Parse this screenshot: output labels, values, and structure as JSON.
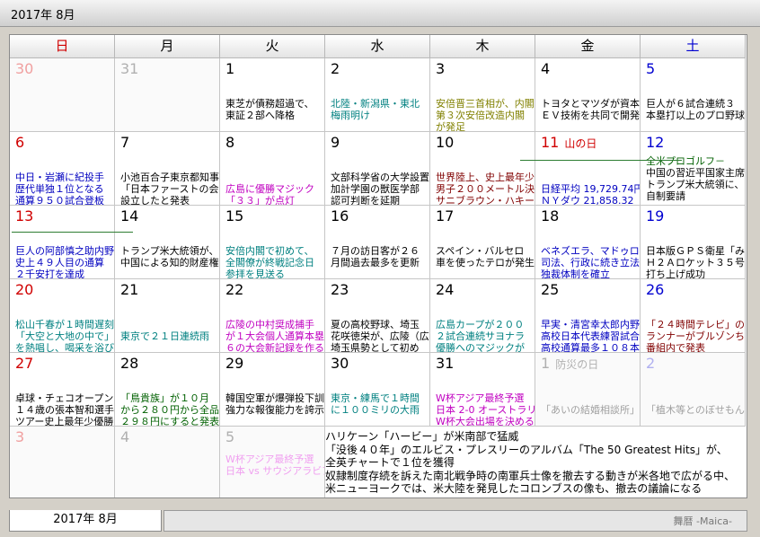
{
  "title": "2017年 8月",
  "tab_label": "2017年 8月",
  "brand": "舞暦 -Maica-",
  "weekdays": [
    {
      "label": "日",
      "color": "#d00000"
    },
    {
      "label": "月",
      "color": "#000000"
    },
    {
      "label": "火",
      "color": "#000000"
    },
    {
      "label": "水",
      "color": "#000000"
    },
    {
      "label": "木",
      "color": "#000000"
    },
    {
      "label": "金",
      "color": "#000000"
    },
    {
      "label": "土",
      "color": "#0000d0"
    }
  ],
  "weeks": [
    [
      {
        "day": "30",
        "color": "#f0a0a0",
        "dim": true,
        "events": []
      },
      {
        "day": "31",
        "color": "#b0b0b0",
        "dim": true,
        "events": []
      },
      {
        "day": "1",
        "color": "#000000",
        "events": [
          {
            "text": "東芝が債務超過で、",
            "color": "#000000"
          },
          {
            "text": "東証２部へ降格",
            "color": "#000000"
          }
        ]
      },
      {
        "day": "2",
        "color": "#000000",
        "events": [
          {
            "text": "北陸・新潟県・東北",
            "color": "#008080"
          },
          {
            "text": "梅雨明け",
            "color": "#008080"
          }
        ]
      },
      {
        "day": "3",
        "color": "#000000",
        "events": [
          {
            "text": "安倍晋三首相が、内閣",
            "color": "#808000"
          },
          {
            "text": "第３次安倍改造内閣",
            "color": "#808000"
          },
          {
            "text": "が発足",
            "color": "#808000"
          }
        ]
      },
      {
        "day": "4",
        "color": "#000000",
        "events": [
          {
            "text": "トヨタとマツダが資本",
            "color": "#000000"
          },
          {
            "text": "ＥＶ技術を共同で開発",
            "color": "#000000"
          }
        ]
      },
      {
        "day": "5",
        "color": "#0000d0",
        "events": [
          {
            "text": "巨人が６試合連続３",
            "color": "#000000"
          },
          {
            "text": "本塁打以上のプロ野球",
            "color": "#000000"
          }
        ]
      }
    ],
    [
      {
        "day": "6",
        "color": "#d00000",
        "events": [
          {
            "text": "中日・岩瀬に紀投手",
            "color": "#0000c0"
          },
          {
            "text": "歴代単独１位となる",
            "color": "#0000c0"
          },
          {
            "text": "通算９５０試合登板",
            "color": "#0000c0"
          }
        ]
      },
      {
        "day": "7",
        "color": "#000000",
        "events": [
          {
            "text": "小池百合子東京都知事",
            "color": "#000000"
          },
          {
            "text": "「日本ファーストの会",
            "color": "#000000"
          },
          {
            "text": "設立したと発表",
            "color": "#000000"
          }
        ]
      },
      {
        "day": "8",
        "color": "#000000",
        "events": [
          {
            "text": "",
            "color": "#000000"
          },
          {
            "text": "広島に優勝マジック",
            "color": "#c000c0"
          },
          {
            "text": "「３３」が点灯",
            "color": "#c000c0"
          }
        ]
      },
      {
        "day": "9",
        "color": "#000000",
        "events": [
          {
            "text": "文部科学省の大学設置",
            "color": "#000000"
          },
          {
            "text": "加計学園の獣医学部",
            "color": "#000000"
          },
          {
            "text": "認可判断を延期",
            "color": "#000000"
          }
        ]
      },
      {
        "day": "10",
        "color": "#000000",
        "events": [
          {
            "text": "世界陸上、史上最年少",
            "color": "#800000"
          },
          {
            "text": "男子２００メートル決",
            "color": "#800000"
          },
          {
            "text": "サニブラウン・ハキーム",
            "color": "#800000"
          }
        ]
      },
      {
        "day": "11",
        "color": "#d00000",
        "holiday": "山の日",
        "events": [
          {
            "text": "",
            "color": "#000000"
          },
          {
            "text": "日経平均 19,729.74円",
            "color": "#0000c0"
          },
          {
            "text": "ＮＹダウ 21,858.32",
            "color": "#0000c0"
          }
        ]
      },
      {
        "day": "12",
        "color": "#0000d0",
        "events": [
          {
            "text": "全米プロゴルフ－",
            "color": "#006000"
          },
          {
            "text": "中国の習近平国家主席",
            "color": "#000000"
          },
          {
            "text": "トランプ米大統領に、",
            "color": "#000000"
          },
          {
            "text": "自制要請",
            "color": "#000000"
          }
        ]
      }
    ],
    [
      {
        "day": "13",
        "color": "#d00000",
        "events": [
          {
            "text": "巨人の阿部慎之助内野",
            "color": "#0000c0"
          },
          {
            "text": "史上４９人目の通算",
            "color": "#0000c0"
          },
          {
            "text": "２千安打を達成",
            "color": "#0000c0"
          }
        ]
      },
      {
        "day": "14",
        "color": "#000000",
        "events": [
          {
            "text": "トランプ米大統領が、",
            "color": "#000000"
          },
          {
            "text": "中国による知的財産権",
            "color": "#000000"
          }
        ]
      },
      {
        "day": "15",
        "color": "#000000",
        "events": [
          {
            "text": "安倍内閣で初めて、",
            "color": "#008080"
          },
          {
            "text": "全閣僚が終戦記念日",
            "color": "#008080"
          },
          {
            "text": "参拝を見送る",
            "color": "#008080"
          }
        ]
      },
      {
        "day": "16",
        "color": "#000000",
        "events": [
          {
            "text": "７月の訪日客が２６",
            "color": "#000000"
          },
          {
            "text": "月間過去最多を更新",
            "color": "#000000"
          }
        ]
      },
      {
        "day": "17",
        "color": "#000000",
        "events": [
          {
            "text": "スペイン・バルセロ",
            "color": "#000000"
          },
          {
            "text": "車を使ったテロが発生",
            "color": "#000000"
          }
        ]
      },
      {
        "day": "18",
        "color": "#000000",
        "events": [
          {
            "text": "ベネズエラ、マドゥロ",
            "color": "#0000c0"
          },
          {
            "text": "司法、行政に続き立法",
            "color": "#0000c0"
          },
          {
            "text": "独裁体制を確立",
            "color": "#0000c0"
          }
        ]
      },
      {
        "day": "19",
        "color": "#0000d0",
        "events": [
          {
            "text": "日本版ＧＰＳ衛星「み",
            "color": "#000000"
          },
          {
            "text": "Ｈ２Ａロケット３５号",
            "color": "#000000"
          },
          {
            "text": "打ち上げ成功",
            "color": "#000000"
          }
        ]
      }
    ],
    [
      {
        "day": "20",
        "color": "#d00000",
        "events": [
          {
            "text": "松山千春が１時間遅刻",
            "color": "#008080"
          },
          {
            "text": "「大空と大地の中で」",
            "color": "#008080"
          },
          {
            "text": "を熱唱し、喝采を浴び",
            "color": "#008080"
          }
        ]
      },
      {
        "day": "21",
        "color": "#000000",
        "events": [
          {
            "text": "",
            "color": "#000000"
          },
          {
            "text": "東京で２１日連続雨",
            "color": "#008080"
          }
        ]
      },
      {
        "day": "22",
        "color": "#000000",
        "events": [
          {
            "text": "広陵の中村奨成捕手",
            "color": "#c000c0"
          },
          {
            "text": "が１大会個人通算本塁",
            "color": "#c000c0"
          },
          {
            "text": "６の大会新記録を作る",
            "color": "#c000c0"
          }
        ]
      },
      {
        "day": "23",
        "color": "#000000",
        "events": [
          {
            "text": "夏の高校野球、埼玉",
            "color": "#000000"
          },
          {
            "text": "花咲徳栄が、広陵（広",
            "color": "#000000"
          },
          {
            "text": "埼玉県勢として初め",
            "color": "#000000"
          }
        ]
      },
      {
        "day": "24",
        "color": "#000000",
        "events": [
          {
            "text": "広島カープが２００",
            "color": "#008080"
          },
          {
            "text": "２試合連続サヨナラ",
            "color": "#008080"
          },
          {
            "text": "優勝へのマジックが",
            "color": "#008080"
          }
        ]
      },
      {
        "day": "25",
        "color": "#000000",
        "events": [
          {
            "text": "早実・清宮幸太郎内野",
            "color": "#0000c0"
          },
          {
            "text": "高校日本代表練習試合",
            "color": "#0000c0"
          },
          {
            "text": "高校通算最多１０８本",
            "color": "#0000c0"
          }
        ]
      },
      {
        "day": "26",
        "color": "#0000d0",
        "events": [
          {
            "text": "「２４時間テレビ」の",
            "color": "#800000"
          },
          {
            "text": "ランナーがブルゾンち",
            "color": "#800000"
          },
          {
            "text": "番組内で発表",
            "color": "#800000"
          }
        ]
      }
    ],
    [
      {
        "day": "27",
        "color": "#d00000",
        "events": [
          {
            "text": "卓球・チェコオープン",
            "color": "#000000"
          },
          {
            "text": "１４歳の張本智和選手",
            "color": "#000000"
          },
          {
            "text": "ツアー史上最年少優勝",
            "color": "#000000"
          }
        ]
      },
      {
        "day": "28",
        "color": "#000000",
        "events": [
          {
            "text": "「鳥貴族」が１０月",
            "color": "#006000"
          },
          {
            "text": "から２８０円から全品",
            "color": "#006000"
          },
          {
            "text": "２９８円にすると発表",
            "color": "#006000"
          }
        ]
      },
      {
        "day": "29",
        "color": "#000000",
        "events": [
          {
            "text": "韓国空軍が爆弾投下訓",
            "color": "#000000"
          },
          {
            "text": "強力な報復能力を誇示",
            "color": "#000000"
          }
        ]
      },
      {
        "day": "30",
        "color": "#000000",
        "events": [
          {
            "text": "東京・練馬で１時間",
            "color": "#008080"
          },
          {
            "text": "に１００ミリの大雨",
            "color": "#008080"
          }
        ]
      },
      {
        "day": "31",
        "color": "#000000",
        "events": [
          {
            "text": "W杯アジア最終予選",
            "color": "#c000c0"
          },
          {
            "text": "日本 2-0 オーストラリア",
            "color": "#c000c0"
          },
          {
            "text": "W杯大会出場を決める",
            "color": "#c000c0"
          }
        ]
      },
      {
        "day": "1",
        "color": "#b0b0b0",
        "dim": true,
        "holiday": "防災の日",
        "events": [
          {
            "text": "",
            "color": "#000000"
          },
          {
            "text": "「あいの結婚相談所」",
            "color": "#a0a0a0"
          }
        ]
      },
      {
        "day": "2",
        "color": "#b0b0f0",
        "dim": true,
        "events": [
          {
            "text": "",
            "color": "#000000"
          },
          {
            "text": "「植木等とのぼせもん",
            "color": "#a0a0a0"
          }
        ]
      }
    ],
    [
      {
        "day": "3",
        "color": "#f0a0a0",
        "dim": true,
        "events": []
      },
      {
        "day": "4",
        "color": "#b0b0b0",
        "dim": true,
        "events": []
      },
      {
        "day": "5",
        "color": "#b0b0b0",
        "dim": true,
        "events": [
          {
            "text": "W杯アジア最終予選",
            "color": "#f0a0f0"
          },
          {
            "text": "日本 vs サウジアラビア",
            "color": "#f0a0f0"
          }
        ]
      }
    ]
  ],
  "bottom_events": [
    "ハリケーン「ハービー」が米南部で猛威",
    "「没後４０年」のエルビス・プレスリーのアルバム「The 50 Greatest Hits」が、",
    "全英チャートで１位を獲得",
    "奴隷制度存続を訴えた南北戦争時の南軍兵士像を撤去する動きが米各地で広がる中、",
    "米ニューヨークでは、米大陸を発見したコロンブスの像も、撤去の議論になる"
  ]
}
